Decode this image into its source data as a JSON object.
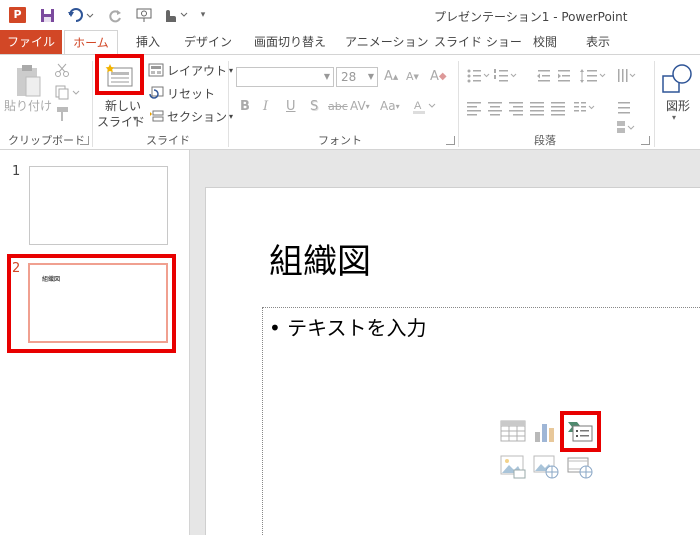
{
  "window": {
    "title": "プレゼンテーション1 - PowerPoint",
    "app_icon_letter": "P"
  },
  "tabs": [
    {
      "label": "ファイル"
    },
    {
      "label": "ホーム"
    },
    {
      "label": "挿入"
    },
    {
      "label": "デザイン"
    },
    {
      "label": "画面切り替え"
    },
    {
      "label": "アニメーション"
    },
    {
      "label": "スライド ショー"
    },
    {
      "label": "校閲"
    },
    {
      "label": "表示"
    }
  ],
  "ribbon": {
    "clipboard": {
      "paste_label": "貼り付け",
      "group_label": "クリップボード"
    },
    "slides": {
      "new_slide_line1": "新しい",
      "new_slide_line2": "スライド",
      "layout_label": "レイアウト",
      "reset_label": "リセット",
      "section_label": "セクション",
      "group_label": "スライド"
    },
    "font": {
      "font_size": "28",
      "group_label": "フォント",
      "bold": "B",
      "italic": "I",
      "underline": "U",
      "shadow": "S",
      "strike": "abc",
      "spacing": "AV",
      "case": "Aa",
      "grow": "A",
      "shrink": "A",
      "clear": "A"
    },
    "paragraph": {
      "group_label": "段落"
    },
    "drawing": {
      "shapes_label": "図形"
    }
  },
  "thumbnails": [
    {
      "number": "1",
      "title": ""
    },
    {
      "number": "2",
      "title": "組織図"
    }
  ],
  "slide": {
    "title": "組織図",
    "placeholder_text": "• テキストを入力"
  },
  "colors": {
    "accent": "#d24726",
    "highlight": "#e80000"
  }
}
